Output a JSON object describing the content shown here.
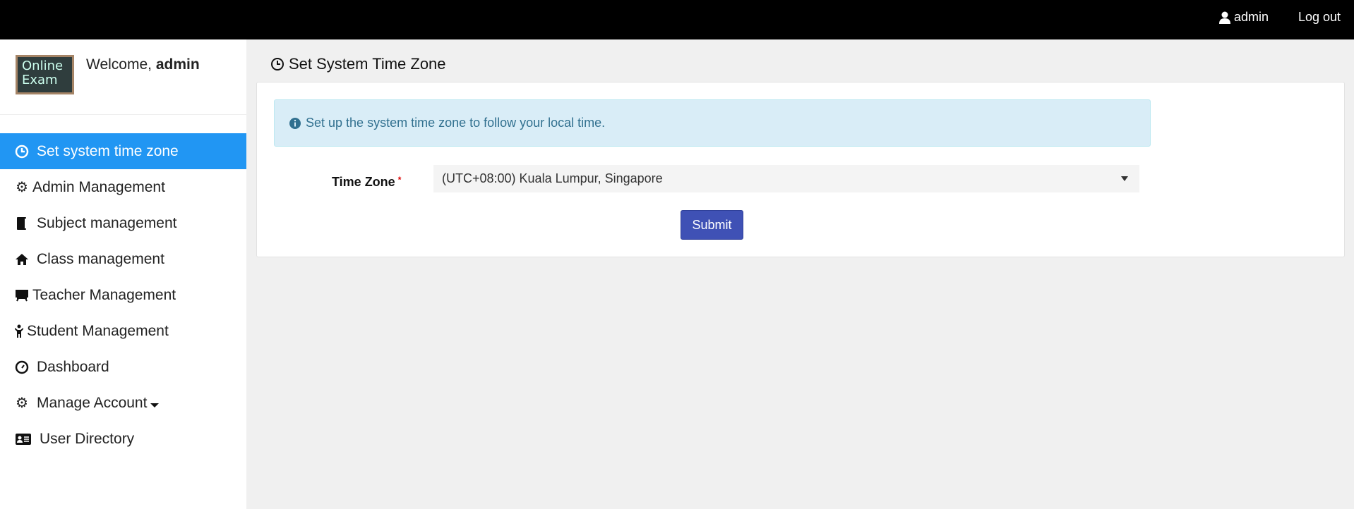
{
  "topbar": {
    "user_label": "admin",
    "logout_label": "Log out"
  },
  "sidebar": {
    "logo_text": "Online Exam",
    "welcome_prefix": "Welcome,",
    "welcome_user": "admin",
    "items": [
      {
        "label": "Set system time zone",
        "icon": "clock-icon"
      },
      {
        "label": "Admin Management",
        "icon": "gear-icon"
      },
      {
        "label": "Subject management",
        "icon": "book-icon"
      },
      {
        "label": "Class management",
        "icon": "home-icon"
      },
      {
        "label": "Teacher Management",
        "icon": "blackboard-icon"
      },
      {
        "label": "Student Management",
        "icon": "child-icon"
      },
      {
        "label": "Dashboard",
        "icon": "dashboard-icon"
      },
      {
        "label": "Manage Account",
        "icon": "gear-icon"
      },
      {
        "label": "User Directory",
        "icon": "id-card-icon"
      }
    ]
  },
  "main": {
    "title": "Set System Time Zone",
    "alert": "Set up the system time zone to follow your local time.",
    "form": {
      "time_zone_label": "Time Zone",
      "required_mark": "*",
      "time_zone_value": "(UTC+08:00) Kuala Lumpur, Singapore",
      "submit_label": "Submit"
    }
  },
  "colors": {
    "accent": "#2196f3",
    "button": "#3f51b5",
    "alert_bg": "#d9edf7"
  }
}
